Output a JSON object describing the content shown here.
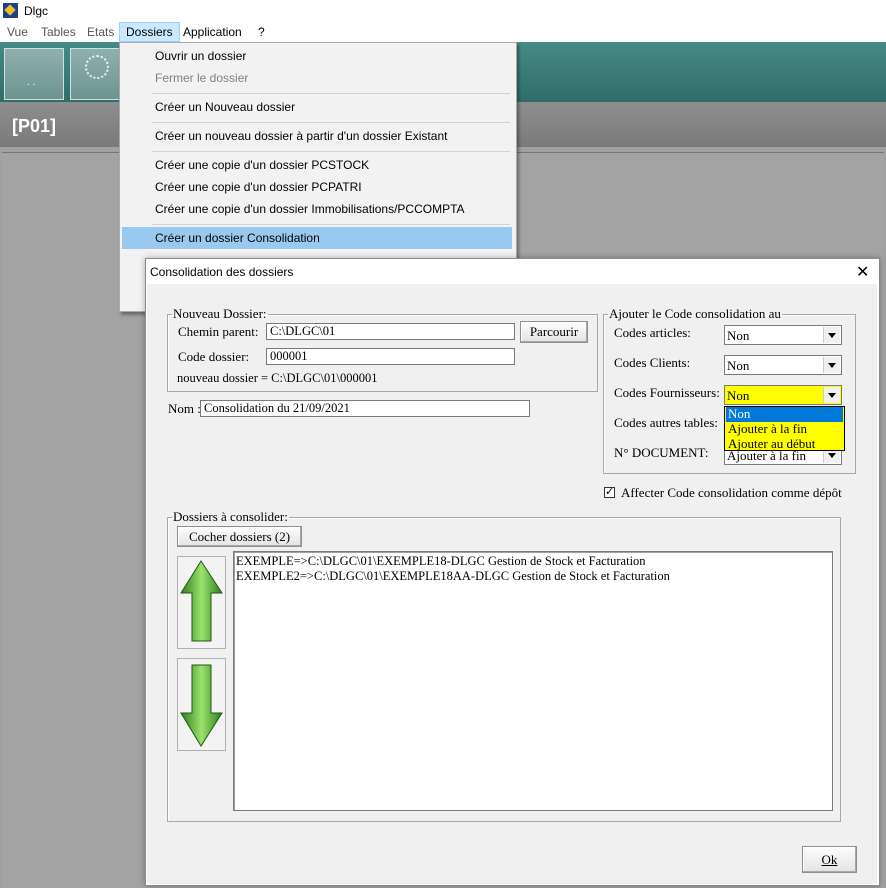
{
  "app": {
    "title": "Dlgc"
  },
  "menubar": {
    "items": [
      "Vue",
      "Tables",
      "Etats",
      "Dossiers",
      "Application",
      "?"
    ]
  },
  "tab": {
    "label": "[P01]"
  },
  "dossiers_menu": {
    "items": [
      {
        "label": "Ouvrir un dossier",
        "enabled": true
      },
      {
        "label": "Fermer le dossier",
        "enabled": false
      },
      {
        "label": "Créer un Nouveau dossier",
        "enabled": true
      },
      {
        "label": "Créer un nouveau dossier  à partir d'un dossier Existant",
        "enabled": true
      },
      {
        "label": "Créer une copie d'un dossier PCSTOCK",
        "enabled": true
      },
      {
        "label": "Créer une copie d'un dossier PCPATRI",
        "enabled": true
      },
      {
        "label": "Créer une copie d'un dossier Immobilisations/PCCOMPTA",
        "enabled": true
      },
      {
        "label": "Créer un dossier Consolidation",
        "enabled": true,
        "highlighted": true
      }
    ]
  },
  "dialog": {
    "title": "Consolidation des dossiers",
    "close_glyph": "✕",
    "nouveau": {
      "legend": "Nouveau Dossier:",
      "chemin_label": "Chemin parent:",
      "chemin_value": "C:\\DLGC\\01",
      "parcourir_label": "Parcourir",
      "code_label": "Code dossier:",
      "code_value": "000001",
      "result_text": "nouveau dossier = C:\\DLGC\\01\\000001"
    },
    "nom": {
      "label": "Nom :",
      "value": "Consolidation du 21/09/2021"
    },
    "code_conso": {
      "legend": "Ajouter le Code consolidation au",
      "articles_label": "Codes articles:",
      "articles_value": "Non",
      "clients_label": "Codes Clients:",
      "clients_value": "Non",
      "fournisseurs_label": "Codes Fournisseurs:",
      "fournisseurs_value": "Non",
      "autres_label": "Codes autres tables:",
      "document_label": "N° DOCUMENT:",
      "document_value": "Ajouter à la fin",
      "dropdown_options": [
        "Non",
        "Ajouter à la fin",
        "Ajouter au début"
      ],
      "dropdown_selected": "Non"
    },
    "affecter": {
      "label": "Affecter Code consolidation comme dépôt",
      "checked": true,
      "check_glyph": "✓"
    },
    "dossiers": {
      "legend": "Dossiers à consolider:",
      "cocher_label": "Cocher dossiers (2)",
      "rows": [
        "EXEMPLE=>C:\\DLGC\\01\\EXEMPLE18-DLGC Gestion de Stock et Facturation",
        "EXEMPLE2=>C:\\DLGC\\01\\EXEMPLE18AA-DLGC Gestion de Stock et Facturation"
      ]
    },
    "ok_label": "Ok"
  },
  "colors": {
    "toolbar": "#3f7f7b",
    "menu_highlight": "#99c9ef",
    "combo_highlight": "#ffff00",
    "selection": "#0078d7"
  }
}
